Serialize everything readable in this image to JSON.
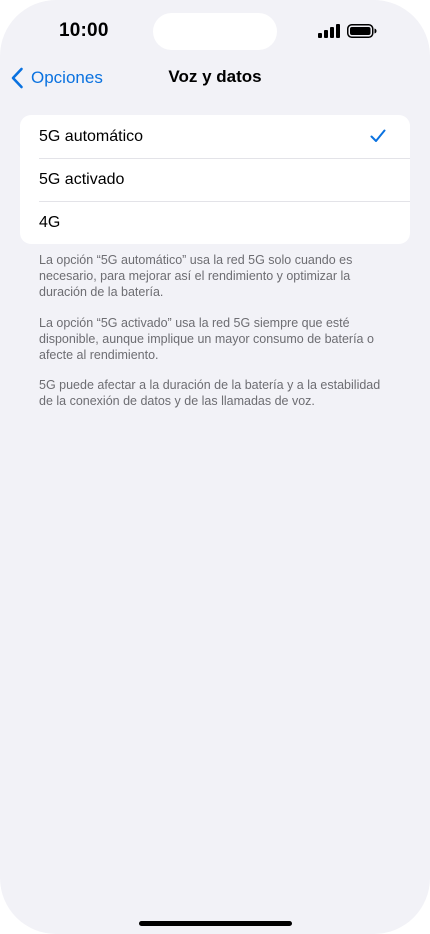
{
  "status_bar": {
    "time": "10:00",
    "icons": [
      "cellular-signal-icon",
      "battery-icon"
    ]
  },
  "nav": {
    "back_label": "Opciones",
    "title": "Voz y datos"
  },
  "options": [
    {
      "label": "5G automático",
      "selected": true
    },
    {
      "label": "5G activado",
      "selected": false
    },
    {
      "label": "4G",
      "selected": false
    }
  ],
  "footnotes": [
    "La opción “5G automático” usa la red 5G solo cuando es necesario, para mejorar así el rendimiento y optimizar la duración de la batería.",
    "La opción “5G activado” usa la red 5G siempre que esté disponible, aunque implique un mayor consumo de batería o afecte al rendimiento.",
    "5G puede afectar a la duración de la batería y a la estabilidad de la conexión de datos y de las llamadas de voz."
  ],
  "colors": {
    "accent": "#0a72e0",
    "background": "#f2f2f7",
    "card": "#ffffff",
    "footnote_text": "#6d6d72"
  }
}
